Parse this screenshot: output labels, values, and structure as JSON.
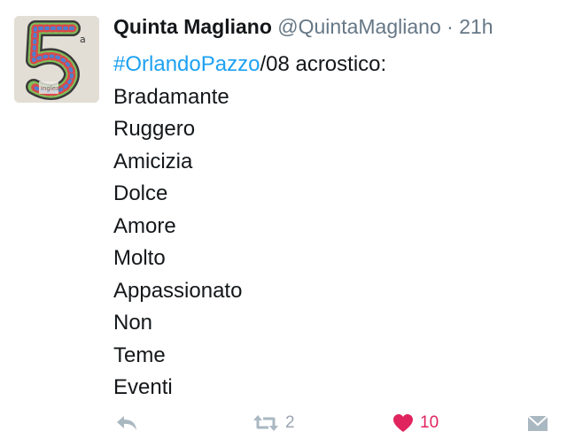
{
  "tweet": {
    "author_name": "Quinta Magliano",
    "author_handle": "@QuintaMagliano",
    "separator": "·",
    "timestamp": "21h",
    "first_line": {
      "hashtag": "#OrlandoPazzo",
      "rest": "/08 acrostico:"
    },
    "lines": [
      "Bradamante",
      "Ruggero",
      "Amicizia",
      "Dolce",
      "Amore",
      "Molto",
      "Appassionato",
      "Non",
      "Teme",
      "Eventi"
    ]
  },
  "actions": {
    "reply_icon": "reply-icon",
    "retweet_icon": "retweet-icon",
    "retweet_count": "2",
    "like_icon": "heart-icon",
    "like_count": "10",
    "dm_icon": "envelope-icon"
  },
  "avatar": {
    "glyph": "5",
    "superscript": "a"
  },
  "colors": {
    "link": "#1da1f2",
    "muted": "#657786",
    "like": "#e0245e",
    "icon": "#aab8c2"
  }
}
